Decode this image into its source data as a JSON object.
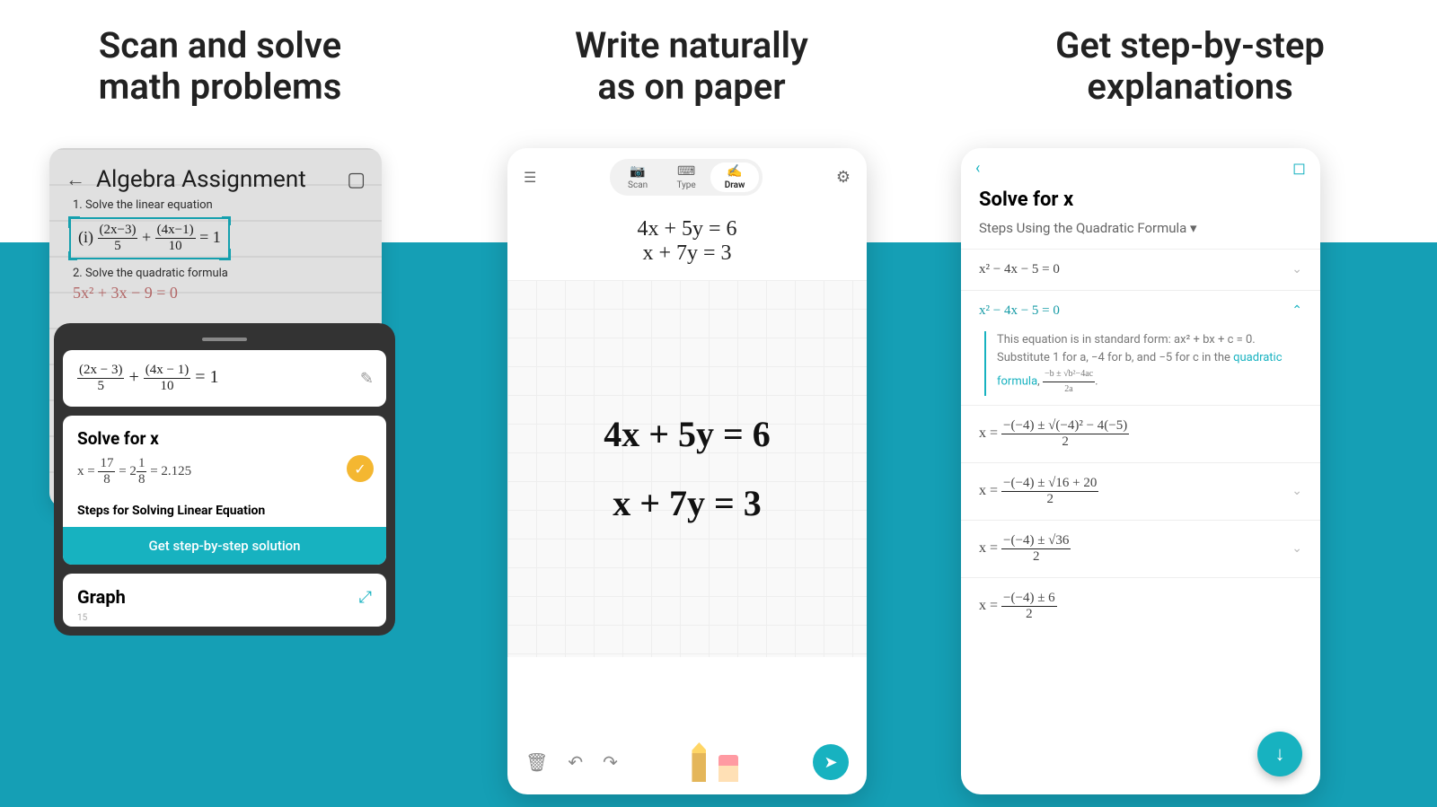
{
  "headings": {
    "panel1_line1": "Scan and solve",
    "panel1_line2": "math problems",
    "panel2_line1": "Write naturally",
    "panel2_line2": "as on paper",
    "panel3_line1": "Get step-by-step",
    "panel3_line2": "explanations"
  },
  "panel1": {
    "paper_title": "Algebra Assignment",
    "q1": "1. Solve the linear equation",
    "q1_label": "(i)",
    "eq1_num1": "(2x−3)",
    "eq1_den1": "5",
    "eq1_plus": "+",
    "eq1_num2": "(4x−1)",
    "eq1_den2": "10",
    "eq1_eq": "= 1",
    "q2": "2. Solve the quadratic formula",
    "eq2": "5x² + 3x − 9 = 0",
    "card1_num1": "(2x − 3)",
    "card1_den1": "5",
    "card1_plus": "+",
    "card1_num2": "(4x − 1)",
    "card1_den2": "10",
    "card1_eq": "= 1",
    "card2_title": "Solve for x",
    "card2_solution_pre": "x =",
    "card2_sol_num1": "17",
    "card2_sol_den1": "8",
    "card2_sol_eq1": "= 2",
    "card2_sol_num2": "1",
    "card2_sol_den2": "8",
    "card2_sol_decimal": "= 2.125",
    "card2_steps_label": "Steps for Solving Linear Equation",
    "card2_button": "Get step-by-step solution",
    "card3_title": "Graph",
    "card3_ytick": "15"
  },
  "panel2": {
    "tabs": {
      "scan": "Scan",
      "type": "Type",
      "draw": "Draw"
    },
    "eq_line1": "4x + 5y = 6",
    "eq_line2": "x + 7y = 3",
    "hand1": "4x + 5y = 6",
    "hand2": "x + 7y = 3"
  },
  "panel3": {
    "title": "Solve for x",
    "subtitle": "Steps Using the Quadratic Formula  ▾",
    "step1": "x² − 4x − 5 = 0",
    "step2": "x² − 4x − 5 = 0",
    "explain_pre": "This equation is in standard form: ax² + bx + c = 0. Substitute 1 for a, −4 for b, and −5 for c in the ",
    "explain_link": "quadratic formula",
    "explain_post": ", ",
    "explain_frac_num": "−b ± √b²−4ac",
    "explain_frac_den": "2a",
    "step3_pre": "x =",
    "step3_num": "−(−4) ± √(−4)² − 4(−5)",
    "step3_den": "2",
    "step4_pre": "x =",
    "step4_num": "−(−4) ± √16 + 20",
    "step4_den": "2",
    "step5_pre": "x =",
    "step5_num": "−(−4) ± √36",
    "step5_den": "2",
    "step6_pre": "x =",
    "step6_num": "−(−4) ± 6",
    "step6_den": "2"
  }
}
